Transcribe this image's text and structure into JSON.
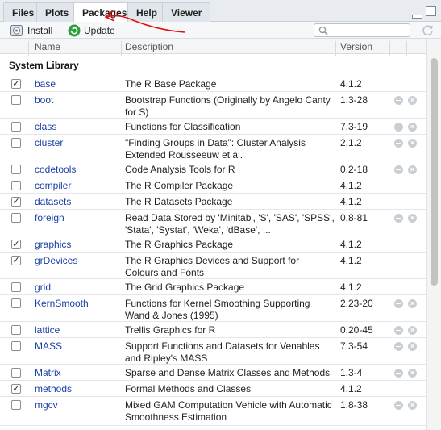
{
  "tabs": [
    {
      "label": "Files"
    },
    {
      "label": "Plots"
    },
    {
      "label": "Packages"
    },
    {
      "label": "Help"
    },
    {
      "label": "Viewer"
    }
  ],
  "toolbar": {
    "install_label": "Install",
    "update_label": "Update",
    "search_placeholder": ""
  },
  "columns": {
    "name": "Name",
    "description": "Description",
    "version": "Version"
  },
  "group_label": "System Library",
  "packages": [
    {
      "name": "base",
      "checked": true,
      "desc": "The R Base Package",
      "version": "4.1.2",
      "actions": false
    },
    {
      "name": "boot",
      "checked": false,
      "desc": "Bootstrap Functions (Originally by Angelo Canty for S)",
      "version": "1.3-28",
      "actions": true
    },
    {
      "name": "class",
      "checked": false,
      "desc": "Functions for Classification",
      "version": "7.3-19",
      "actions": true
    },
    {
      "name": "cluster",
      "checked": false,
      "desc": "\"Finding Groups in Data\": Cluster Analysis Extended Rousseeuw et al.",
      "version": "2.1.2",
      "actions": true
    },
    {
      "name": "codetools",
      "checked": false,
      "desc": "Code Analysis Tools for R",
      "version": "0.2-18",
      "actions": true
    },
    {
      "name": "compiler",
      "checked": false,
      "desc": "The R Compiler Package",
      "version": "4.1.2",
      "actions": false
    },
    {
      "name": "datasets",
      "checked": true,
      "desc": "The R Datasets Package",
      "version": "4.1.2",
      "actions": false
    },
    {
      "name": "foreign",
      "checked": false,
      "desc": "Read Data Stored by 'Minitab', 'S', 'SAS', 'SPSS', 'Stata', 'Systat', 'Weka', 'dBase', ...",
      "version": "0.8-81",
      "actions": true
    },
    {
      "name": "graphics",
      "checked": true,
      "desc": "The R Graphics Package",
      "version": "4.1.2",
      "actions": false
    },
    {
      "name": "grDevices",
      "checked": true,
      "desc": "The R Graphics Devices and Support for Colours and Fonts",
      "version": "4.1.2",
      "actions": false
    },
    {
      "name": "grid",
      "checked": false,
      "desc": "The Grid Graphics Package",
      "version": "4.1.2",
      "actions": false
    },
    {
      "name": "KernSmooth",
      "checked": false,
      "desc": "Functions for Kernel Smoothing Supporting Wand & Jones (1995)",
      "version": "2.23-20",
      "actions": true
    },
    {
      "name": "lattice",
      "checked": false,
      "desc": "Trellis Graphics for R",
      "version": "0.20-45",
      "actions": true
    },
    {
      "name": "MASS",
      "checked": false,
      "desc": "Support Functions and Datasets for Venables and Ripley's MASS",
      "version": "7.3-54",
      "actions": true
    },
    {
      "name": "Matrix",
      "checked": false,
      "desc": "Sparse and Dense Matrix Classes and Methods",
      "version": "1.3-4",
      "actions": true
    },
    {
      "name": "methods",
      "checked": true,
      "desc": "Formal Methods and Classes",
      "version": "4.1.2",
      "actions": false
    },
    {
      "name": "mgcv",
      "checked": false,
      "desc": "Mixed GAM Computation Vehicle with Automatic Smoothness Estimation",
      "version": "1.8-38",
      "actions": true
    }
  ],
  "colors": {
    "link": "#1a3fa6",
    "update_icon": "#2e9e3e",
    "annotation": "#e01010"
  }
}
